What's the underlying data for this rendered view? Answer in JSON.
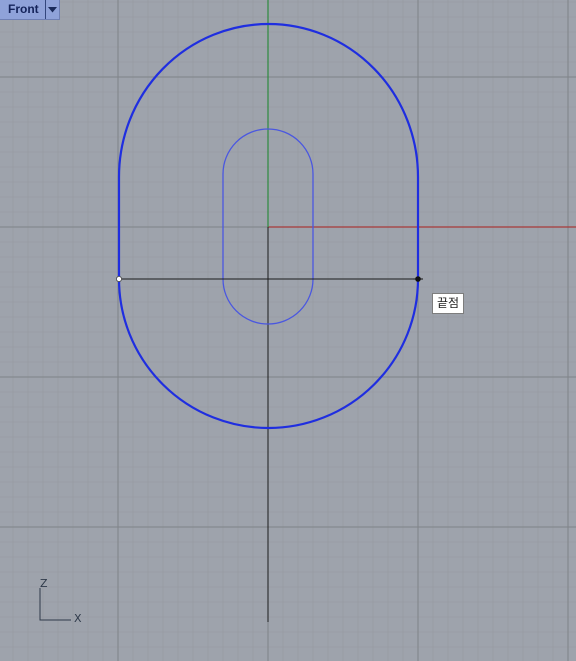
{
  "viewport": {
    "title": "Front",
    "dropdown_icon": "chevron-down-icon"
  },
  "snap_tooltip": {
    "text": "끝점"
  },
  "axis_indicator": {
    "vertical": "Z",
    "horizontal": "X"
  },
  "colors": {
    "background": "#9ea3ac",
    "grid_minor": "#95999f",
    "grid_major": "#7f8388",
    "x_axis": "#a83a3a",
    "y_axis": "#2e8a3e",
    "curve": "#1f2ee0",
    "inner_curve": "#4a57e0",
    "construction_line": "#1b1b1b"
  }
}
